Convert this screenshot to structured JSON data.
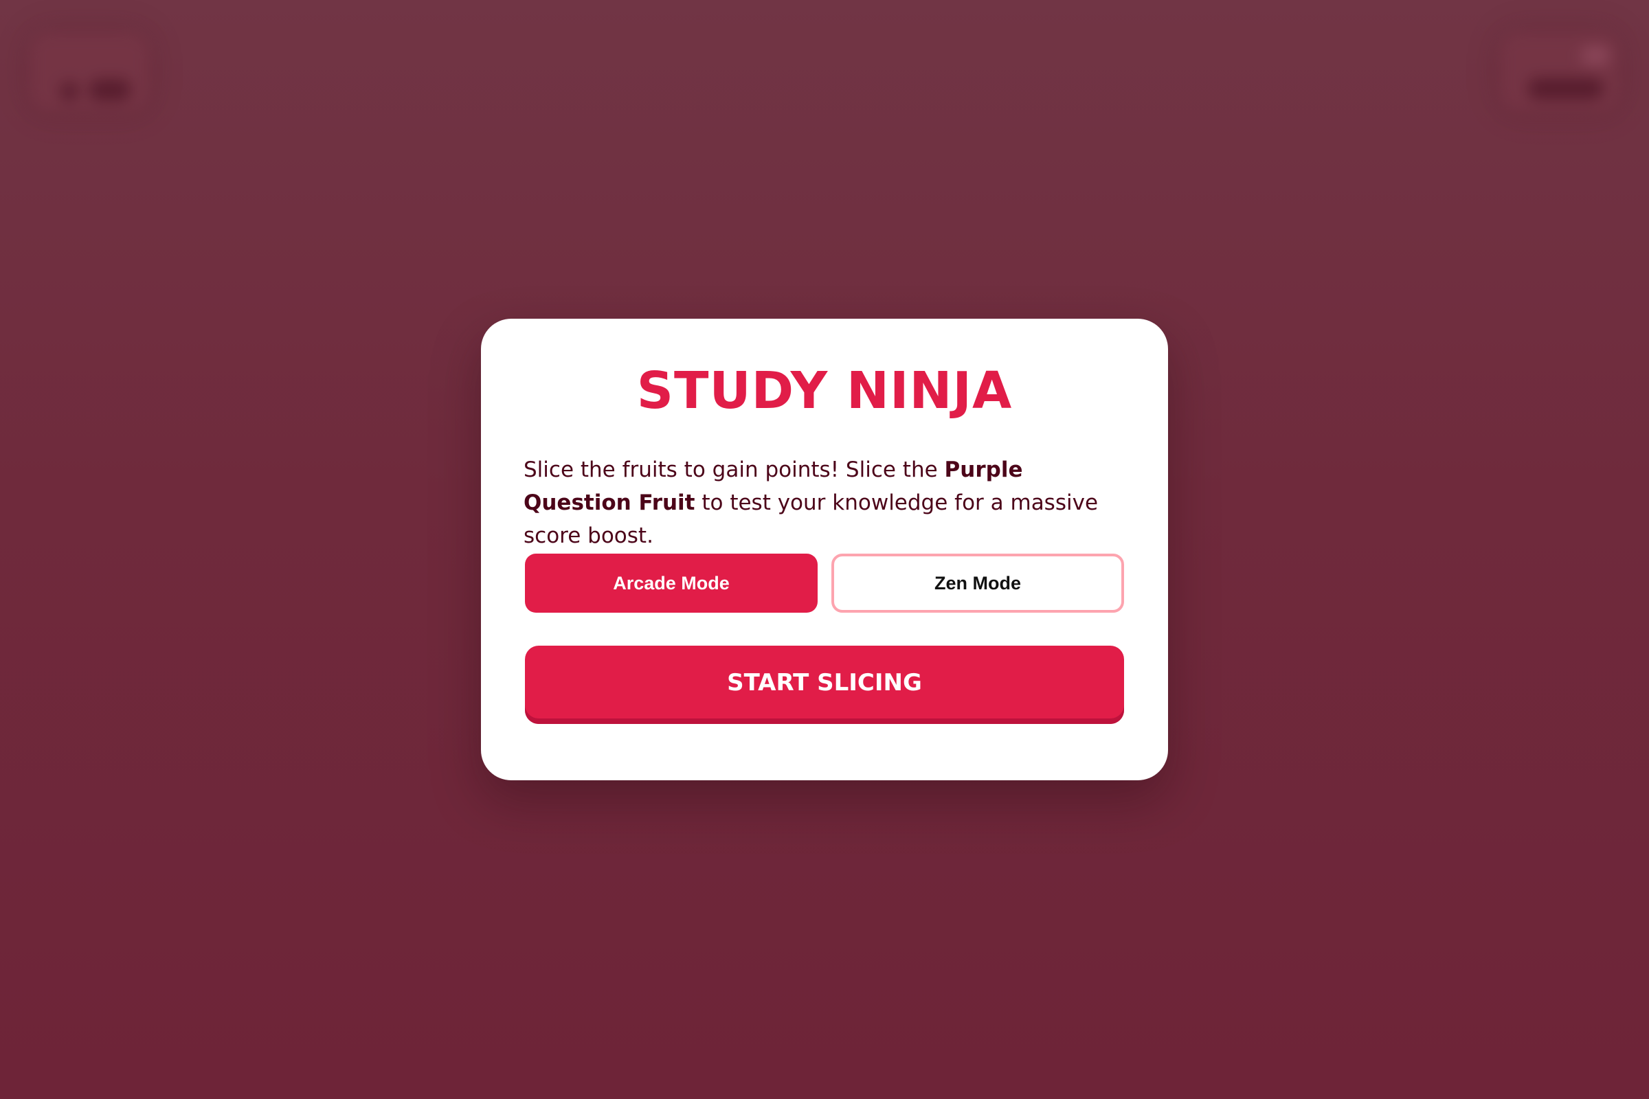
{
  "game": {
    "title": "STUDY NINJA",
    "description": {
      "part1": "Slice the fruits to gain points! Slice the ",
      "highlight": "Purple Question Fruit",
      "part2": " to test your knowledge for a massive score boost."
    },
    "modes": {
      "arcade_label": "Arcade Mode",
      "zen_label": "Zen Mode",
      "selected": "Arcade Mode"
    },
    "start_label": "START SLICING"
  },
  "colors": {
    "accent": "#e11d48",
    "accent_dark": "#be123c",
    "text_dark": "#4c0519",
    "zen_border": "#fda4af",
    "backdrop": "#6f2a3c"
  }
}
